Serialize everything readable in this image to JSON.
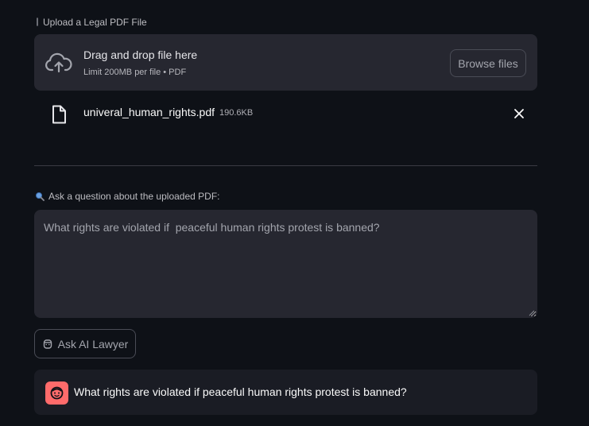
{
  "uploader": {
    "label": "Upload a Legal PDF File",
    "drop_title": "Drag and drop file here",
    "limit_text": "Limit 200MB per file • PDF",
    "browse_label": "Browse files"
  },
  "uploaded_file": {
    "name": "univeral_human_rights.pdf",
    "size": "190.6KB"
  },
  "question": {
    "label": "Ask a question about the uploaded PDF:",
    "value": "What rights are violated if  peaceful human rights protest is banned?"
  },
  "ask_button": {
    "label": "Ask AI Lawyer"
  },
  "chat": {
    "message": "What rights are violated if peaceful human rights protest is banned?"
  },
  "colors": {
    "background": "#0e1117",
    "panel": "#262730",
    "avatar": "#ff6b6b"
  },
  "icons": [
    "paperclip-icon",
    "cloud-upload-icon",
    "file-icon",
    "close-icon",
    "search-icon",
    "judge-icon",
    "user-avatar-icon",
    "resize-grip-icon"
  ]
}
